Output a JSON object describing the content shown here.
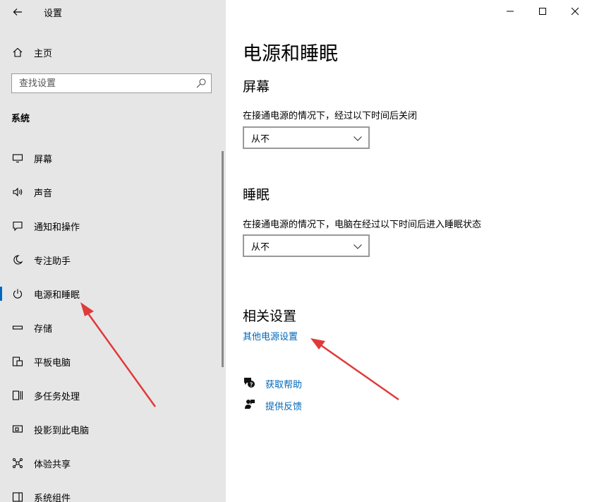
{
  "window": {
    "title": "设置"
  },
  "sidebar": {
    "home_label": "主页",
    "search_placeholder": "查找设置",
    "section_label": "系统",
    "items": [
      {
        "label": "屏幕",
        "icon": "monitor-icon"
      },
      {
        "label": "声音",
        "icon": "speaker-icon"
      },
      {
        "label": "通知和操作",
        "icon": "notification-icon"
      },
      {
        "label": "专注助手",
        "icon": "moon-icon"
      },
      {
        "label": "电源和睡眠",
        "icon": "power-icon",
        "active": true
      },
      {
        "label": "存储",
        "icon": "storage-icon"
      },
      {
        "label": "平板电脑",
        "icon": "tablet-icon"
      },
      {
        "label": "多任务处理",
        "icon": "multitask-icon"
      },
      {
        "label": "投影到此电脑",
        "icon": "project-icon"
      },
      {
        "label": "体验共享",
        "icon": "share-icon"
      },
      {
        "label": "系统组件",
        "icon": "components-icon"
      }
    ]
  },
  "main": {
    "title": "电源和睡眠",
    "screen": {
      "heading": "屏幕",
      "description": "在接通电源的情况下，经过以下时间后关闭",
      "value": "从不"
    },
    "sleep": {
      "heading": "睡眠",
      "description": "在接通电源的情况下，电脑在经过以下时间后进入睡眠状态",
      "value": "从不"
    },
    "related": {
      "heading": "相关设置",
      "link": "其他电源设置"
    },
    "help": {
      "get_help": "获取帮助",
      "feedback": "提供反馈"
    }
  },
  "colors": {
    "accent": "#0067c0",
    "link": "#0067b8",
    "sidebar_bg": "#e6e6e6",
    "annotation_arrow": "#e03a3a"
  }
}
